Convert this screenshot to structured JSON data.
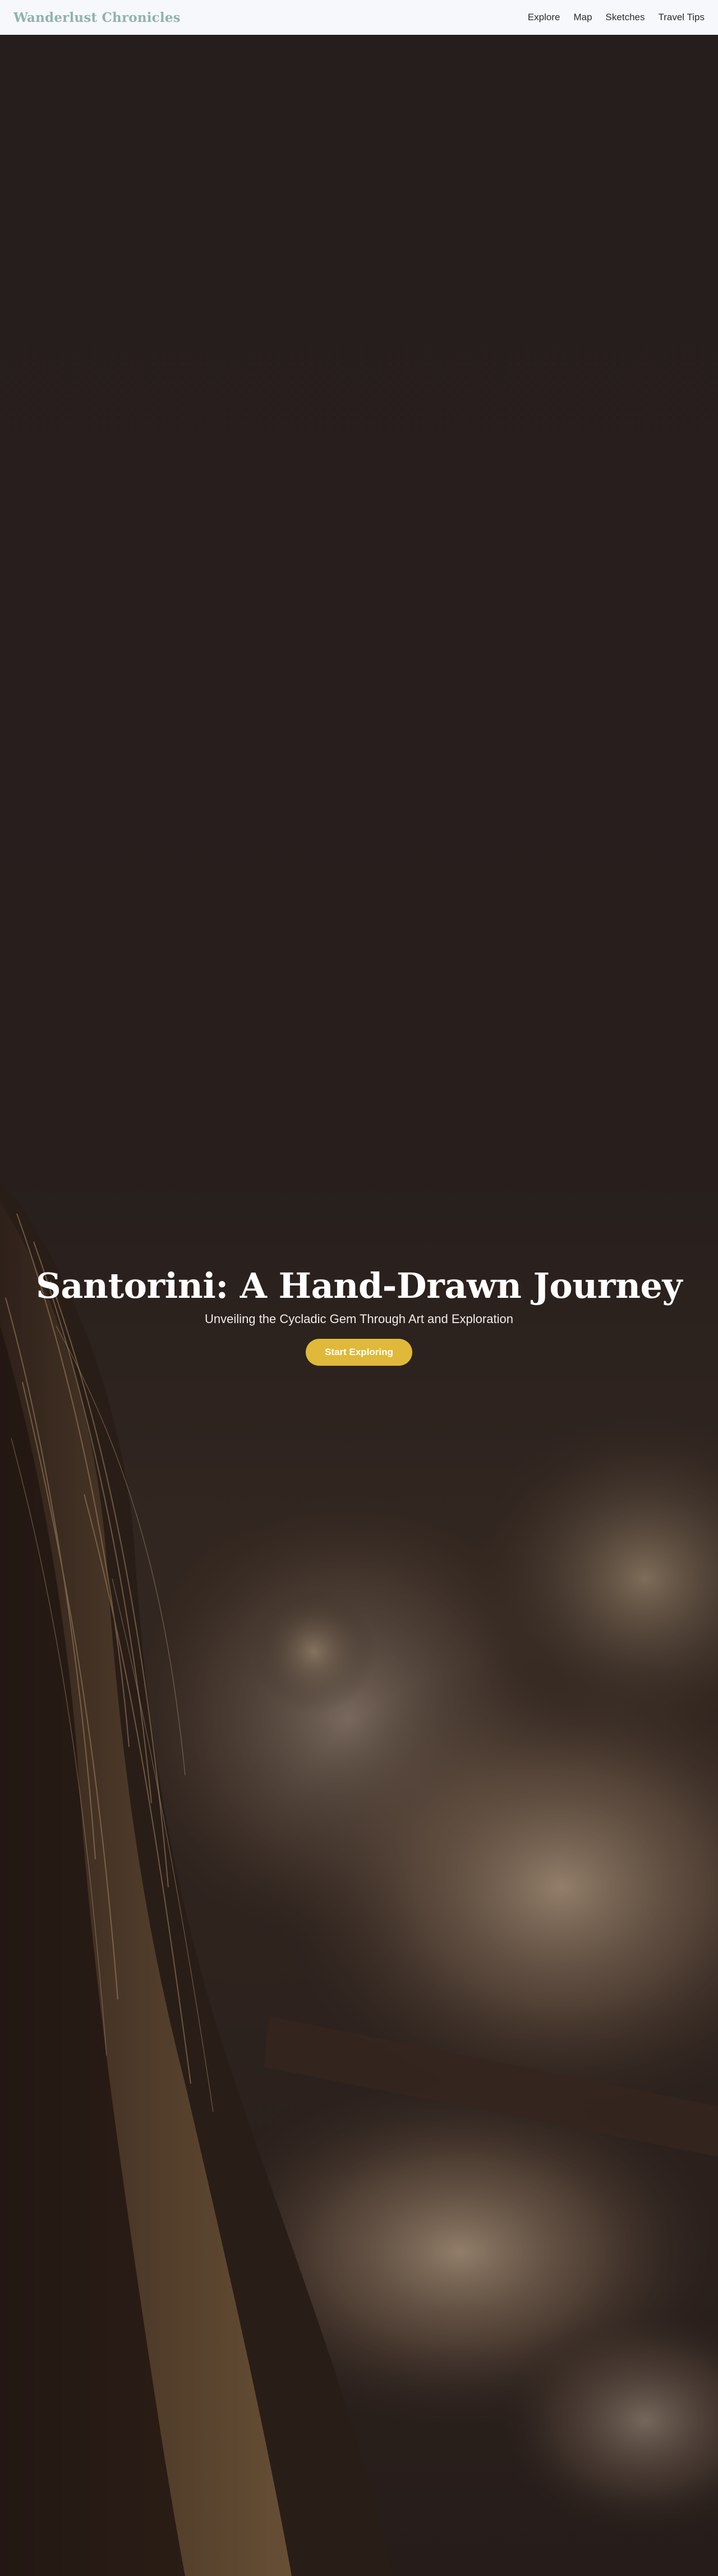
{
  "brand": {
    "name": "Wanderlust Chronicles",
    "color": "#8fb3ae"
  },
  "nav": {
    "links": [
      {
        "label": "Explore"
      },
      {
        "label": "Map"
      },
      {
        "label": "Sketches"
      },
      {
        "label": "Travel Tips"
      }
    ]
  },
  "hero": {
    "title": "Santorini: A Hand-Drawn Journey",
    "subtitle": "Unveiling the Cycladic Gem Through Art and Exploration",
    "cta_label": "Start Exploring",
    "cta_color": "#e0b93a",
    "background_image": "campfire-portrait-photo"
  }
}
